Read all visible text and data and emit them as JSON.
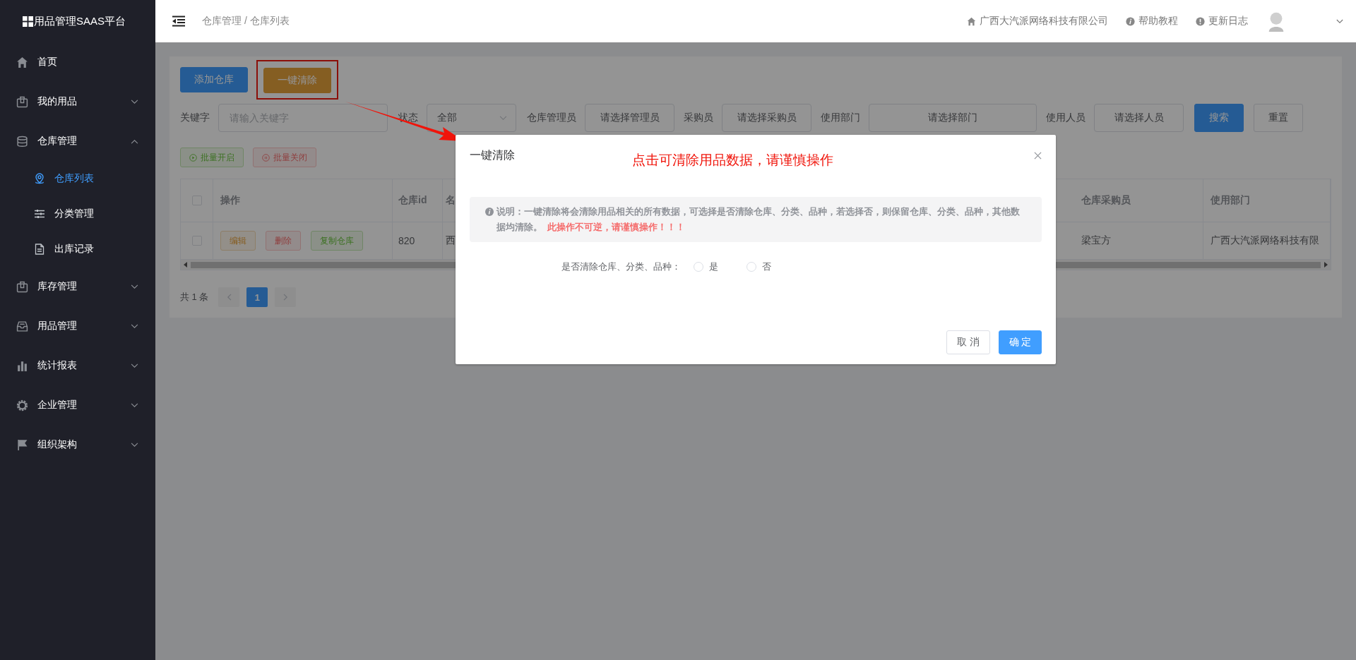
{
  "sidebar": {
    "brand": "用品管理SAAS平台",
    "items": [
      {
        "label": "首页"
      },
      {
        "label": "我的用品",
        "expanded": false
      },
      {
        "label": "仓库管理",
        "expanded": true,
        "children": [
          {
            "label": "仓库列表",
            "selected": true
          },
          {
            "label": "分类管理",
            "selected": false
          },
          {
            "label": "出库记录",
            "selected": false
          }
        ]
      },
      {
        "label": "库存管理",
        "expanded": false
      },
      {
        "label": "用品管理",
        "expanded": false
      },
      {
        "label": "统计报表",
        "expanded": false
      },
      {
        "label": "企业管理",
        "expanded": false
      },
      {
        "label": "组织架构",
        "expanded": false
      }
    ]
  },
  "header": {
    "breadcrumb": "仓库管理 / 仓库列表",
    "links": [
      "广西大汽派网络科技有限公司",
      "帮助教程",
      "更新日志"
    ]
  },
  "toolbar": {
    "buttons": [
      {
        "label": "添加仓库",
        "kind": "primary"
      },
      {
        "label": "一键清除",
        "kind": "warning",
        "highlighted": true
      }
    ]
  },
  "filters": [
    {
      "kind": "input",
      "label": "关键字",
      "placeholder": "请输入关键字"
    },
    {
      "kind": "select",
      "label": "状态",
      "value": "全部"
    },
    {
      "kind": "picker",
      "label": "仓库管理员",
      "value": "请选择管理员"
    },
    {
      "kind": "picker",
      "label": "采购员",
      "value": "请选择采购员"
    },
    {
      "kind": "picker",
      "label": "使用部门",
      "value": "请选择部门"
    },
    {
      "kind": "picker",
      "label": "使用人员",
      "value": "请选择人员"
    }
  ],
  "filter_buttons": [
    {
      "label": "搜索",
      "kind": "primary"
    },
    {
      "label": "重置",
      "kind": "default"
    }
  ],
  "batch_buttons": [
    {
      "label": "批量开启",
      "kind": "success"
    },
    {
      "label": "批量关闭",
      "kind": "danger"
    }
  ],
  "table": {
    "header_checked": false,
    "columns": [
      "操作",
      "仓库id",
      "名",
      "仓库采购员",
      "使用部门"
    ],
    "rows": [
      {
        "checked": false,
        "cells": [
          {
            "kind": "actions",
            "actions": [
              {
                "label": "编辑",
                "kind": "warning"
              },
              {
                "label": "删除",
                "kind": "danger"
              },
              {
                "label": "复制仓库",
                "kind": "success"
              }
            ]
          },
          {
            "kind": "text",
            "text": "820"
          },
          {
            "kind": "text",
            "text": "西"
          },
          {
            "kind": "text",
            "text": "梁宝方"
          },
          {
            "kind": "text",
            "text": "广西大汽派网络科技有限"
          }
        ]
      }
    ]
  },
  "pagination": {
    "total": "共 1 条",
    "pages": [
      {
        "label": "1",
        "selected": true
      }
    ]
  },
  "dialog": {
    "title": "一键清除",
    "annotation": "点击可清除用品数据，请谨慎操作",
    "note": "说明：一键清除将会清除用品相关的所有数据，可选择是否清除仓库、分类、品种，若选择否，则保留仓库、分类、品种，其他数据均清除。 **此操作不可逆，请谨慎操作！！！**",
    "question": "是否清除仓库、分类、品种：",
    "options": [
      {
        "label": "是",
        "selected": false
      },
      {
        "label": "否",
        "selected": false
      }
    ],
    "buttons": [
      {
        "label": "取 消",
        "kind": "default"
      },
      {
        "label": "确 定",
        "kind": "primary"
      }
    ]
  }
}
